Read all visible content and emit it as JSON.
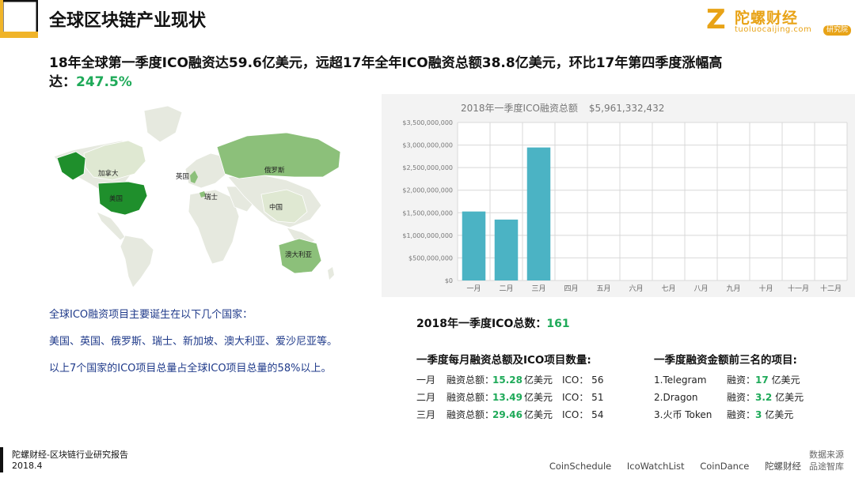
{
  "header": {
    "title": "全球区块链产业现状",
    "logo_mark": "Z",
    "logo_cn": "陀螺财经",
    "logo_en": "tuoluocaijing.com",
    "logo_badge": "研究院"
  },
  "headline": {
    "text": "18年全球第一季度ICO融资达59.6亿美元，远超17年全年ICO融资总额38.8亿美元，环比17年第四季度涨幅高达：",
    "pct": "247.5%"
  },
  "map": {
    "labels": [
      "加拿大",
      "美国",
      "英国",
      "瑞士",
      "俄罗斯",
      "中国",
      "澳大利亚"
    ]
  },
  "chart_data": {
    "type": "bar",
    "title": "2018年一季度ICO融资总额",
    "subtitle": "$5,961,332,432",
    "categories": [
      "一月",
      "二月",
      "三月",
      "四月",
      "五月",
      "六月",
      "七月",
      "八月",
      "九月",
      "十月",
      "十一月",
      "十二月"
    ],
    "values": [
      1528000000,
      1349000000,
      2946000000,
      null,
      null,
      null,
      null,
      null,
      null,
      null,
      null,
      null
    ],
    "yticks": [
      "$0",
      "$500,000,000",
      "$1,000,000,000",
      "$1,500,000,000",
      "$2,000,000,000",
      "$2,500,000,000",
      "$3,000,000,000",
      "$3,500,000,000"
    ],
    "ylim": [
      0,
      3500000000
    ],
    "grid": true,
    "bar_color": "#4bb3c4"
  },
  "desc": {
    "p1": "全球ICO融资项目主要诞生在以下几个国家：",
    "p2": "美国、英国、俄罗斯、瑞士、新加坡、澳大利亚、爱沙尼亚等。",
    "p3": "以上7个国家的ICO项目总量占全球ICO项目总量的58%以上。"
  },
  "total": {
    "label": "2018年一季度ICO总数：",
    "value": "161"
  },
  "monthly": {
    "title": "一季度每月融资总额及ICO项目数量:",
    "rows": [
      {
        "month": "一月",
        "label": "融资总额：",
        "value": "15.28",
        "unit": "亿美元",
        "ico": "ICO：  56"
      },
      {
        "month": "二月",
        "label": "融资总额：",
        "value": "13.49",
        "unit": "亿美元",
        "ico": "ICO：  51"
      },
      {
        "month": "三月",
        "label": "融资总额：",
        "value": "29.46",
        "unit": "亿美元",
        "ico": "ICO：  54"
      }
    ]
  },
  "top3": {
    "title": "一季度融资金额前三名的项目:",
    "rows": [
      {
        "name": "1.Telegram",
        "label": "融资：",
        "value": "17",
        "unit": "亿美元"
      },
      {
        "name": "2.Dragon",
        "label": "融资：",
        "value": "3.2",
        "unit": "亿美元"
      },
      {
        "name": "3.火币 Token",
        "label": "融资：",
        "value": "3",
        "unit": "亿美元"
      }
    ]
  },
  "footer": {
    "report": "陀螺财经-区块链行业研究报告",
    "date": "2018.4",
    "sources": [
      "CoinSchedule",
      "IcoWatchList",
      "CoinDance",
      "陀螺财经"
    ],
    "source_label": "数据来源 品途智库"
  }
}
